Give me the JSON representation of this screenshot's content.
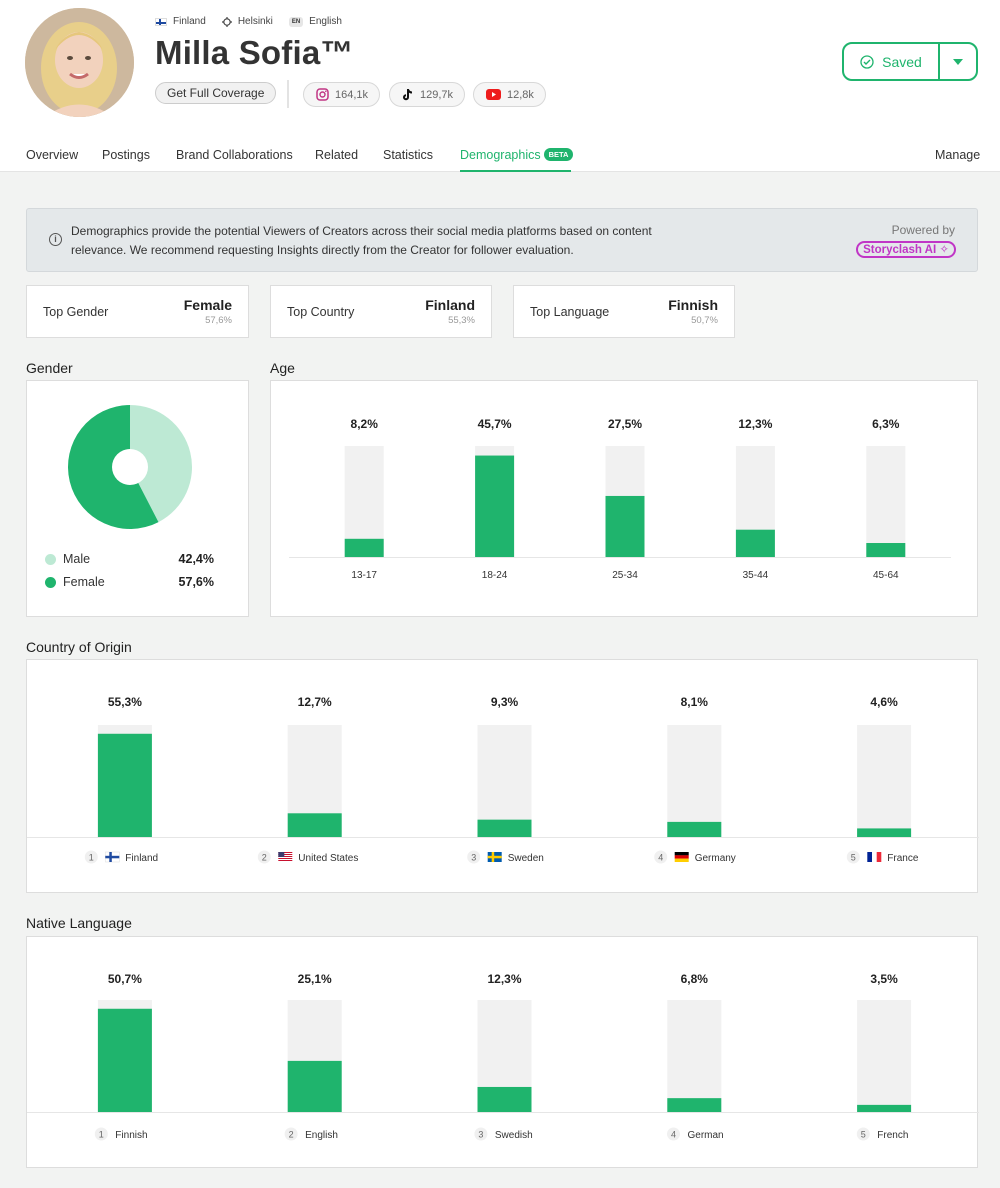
{
  "profile": {
    "country": "Finland",
    "city": "Helsinki",
    "language_code": "EN",
    "language": "English",
    "name": "Milla Sofia™",
    "coverage_button": "Get Full Coverage",
    "socials": [
      {
        "icon": "instagram-icon",
        "count": "164,1k"
      },
      {
        "icon": "tiktok-icon",
        "count": "129,7k"
      },
      {
        "icon": "youtube-icon",
        "count": "12,8k"
      }
    ],
    "saved_label": "Saved"
  },
  "tabs": [
    {
      "label": "Overview"
    },
    {
      "label": "Postings"
    },
    {
      "label": "Brand Collaborations"
    },
    {
      "label": "Related"
    },
    {
      "label": "Statistics"
    },
    {
      "label": "Demographics",
      "badge": "BETA",
      "active": true
    },
    {
      "label": "Manage"
    }
  ],
  "info": {
    "text": "Demographics provide the potential Viewers of Creators across their social media platforms based on content relevance. We recommend requesting Insights directly from the Creator for follower evaluation.",
    "powered_by": "Powered by",
    "brand": "Storyclash AI"
  },
  "top_stats": [
    {
      "label": "Top Gender",
      "value": "Female",
      "sub": "57,6%"
    },
    {
      "label": "Top Country",
      "value": "Finland",
      "sub": "55,3%"
    },
    {
      "label": "Top Language",
      "value": "Finnish",
      "sub": "50,7%"
    }
  ],
  "sections": {
    "gender": "Gender",
    "age": "Age",
    "country": "Country of Origin",
    "language": "Native Language"
  },
  "colors": {
    "accent": "#1fb46d",
    "bar_track": "#f1f1f1",
    "male": "#bde9d4",
    "female": "#1fb46d",
    "brand_ai": "#c036c6"
  },
  "chart_data": [
    {
      "type": "pie",
      "id": "gender",
      "categories": [
        "Male",
        "Female"
      ],
      "values": [
        42.4,
        57.6
      ],
      "labels": [
        "42,4%",
        "57,6%"
      ]
    },
    {
      "type": "bar",
      "id": "age",
      "categories": [
        "13-17",
        "18-24",
        "25-34",
        "35-44",
        "45-64"
      ],
      "values": [
        8.2,
        45.7,
        27.5,
        12.3,
        6.3
      ],
      "labels": [
        "8,2%",
        "45,7%",
        "27,5%",
        "12,3%",
        "6,3%"
      ],
      "ylim": [
        0,
        50
      ]
    },
    {
      "type": "bar",
      "id": "country",
      "categories": [
        "Finland",
        "United States",
        "Sweden",
        "Germany",
        "France"
      ],
      "ranks": [
        "1",
        "2",
        "3",
        "4",
        "5"
      ],
      "flags": [
        "flag-finland",
        "flag-united-states",
        "flag-sweden",
        "flag-germany",
        "flag-france"
      ],
      "values": [
        55.3,
        12.7,
        9.3,
        8.1,
        4.6
      ],
      "labels": [
        "55,3%",
        "12,7%",
        "9,3%",
        "8,1%",
        "4,6%"
      ],
      "ylim": [
        0,
        60
      ]
    },
    {
      "type": "bar",
      "id": "language",
      "categories": [
        "Finnish",
        "English",
        "Swedish",
        "German",
        "French"
      ],
      "ranks": [
        "1",
        "2",
        "3",
        "4",
        "5"
      ],
      "values": [
        50.7,
        25.1,
        12.3,
        6.8,
        3.5
      ],
      "labels": [
        "50,7%",
        "25,1%",
        "12,3%",
        "6,8%",
        "3,5%"
      ],
      "ylim": [
        0,
        55
      ]
    }
  ]
}
